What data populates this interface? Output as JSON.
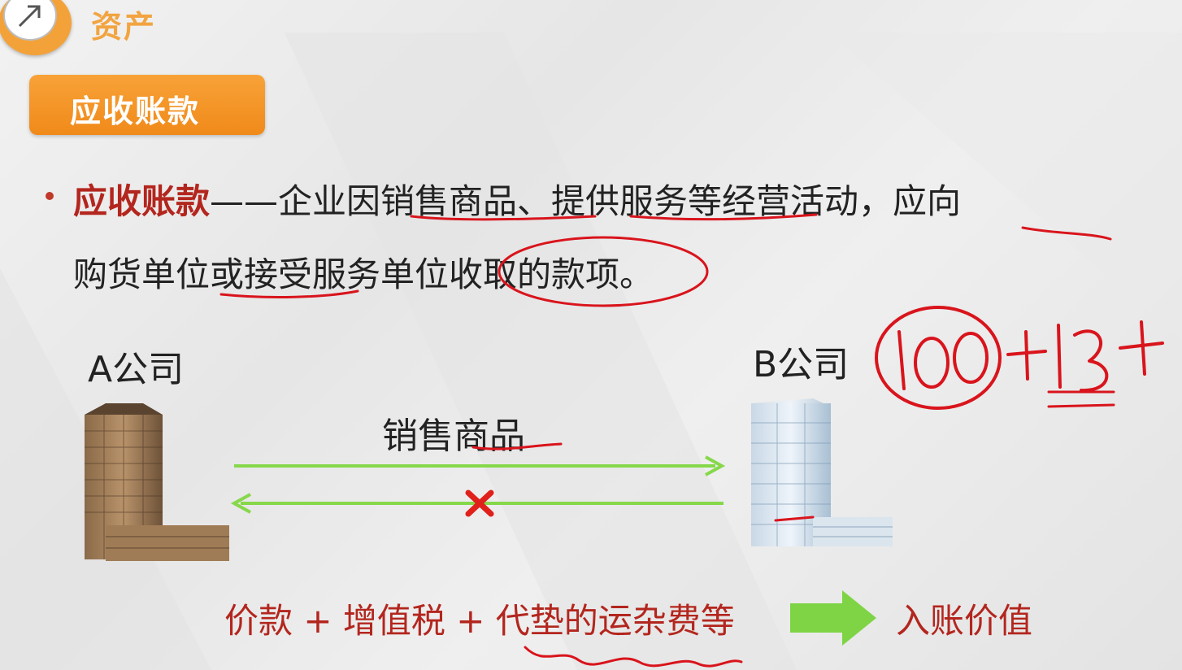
{
  "header": {
    "section_title": "资产",
    "tag_label": "应收账款"
  },
  "definition": {
    "term": "应收账款",
    "line1_rest": "——企业因销售商品、提供服务等经营活动，应向",
    "line2": "购货单位或接受服务单位收取的款项。"
  },
  "diagram": {
    "company_a": "A公司",
    "company_b": "B公司",
    "arrow_label": "销售商品"
  },
  "formula": {
    "text": "价款 + 增值税 + 代垫的运杂费等",
    "result": "入账价值"
  },
  "handwriting": {
    "text": "100+13+"
  },
  "colors": {
    "orange": "#f28c1c",
    "red_text": "#b3261e",
    "arrow_green": "#86d84a",
    "annotation_red": "#d9141c"
  },
  "icons": {
    "logo": "arrow-logo-icon",
    "cross": "cross-icon"
  }
}
